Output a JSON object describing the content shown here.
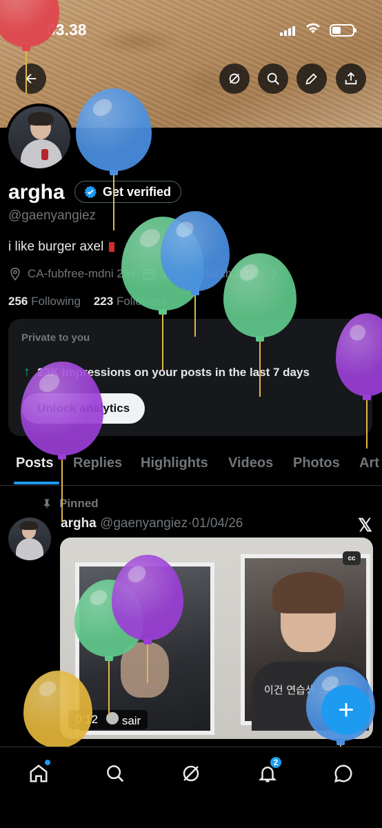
{
  "status_bar": {
    "time": "03.38"
  },
  "header": {
    "back_icon": "arrow-left-icon",
    "actions": [
      "grok-icon",
      "search-icon",
      "edit-icon",
      "share-icon"
    ]
  },
  "profile": {
    "name": "argha",
    "verify_label": "Get verified",
    "handle": "@gaenyangiez",
    "bio": "i like burger axel",
    "location": "CA-fubfree-mdni 25+",
    "joined": "Joined March 2022",
    "following_count": "256",
    "following_label": "Following",
    "followers_count": "223",
    "followers_label": "Followers"
  },
  "analytics_card": {
    "title": "Private to you",
    "close": "×",
    "impressions_text": "23K impressions on your posts in the last 7 days",
    "button_label": "Unlock analytics"
  },
  "tabs": [
    {
      "label": "Posts",
      "active": true
    },
    {
      "label": "Replies",
      "active": false
    },
    {
      "label": "Highlights",
      "active": false
    },
    {
      "label": "Videos",
      "active": false
    },
    {
      "label": "Photos",
      "active": false
    },
    {
      "label": "Art",
      "active": false
    }
  ],
  "post": {
    "pinned_label": "Pinned",
    "author": "argha",
    "handle": "@gaenyangiez",
    "separator": "·",
    "date": "01/04/26",
    "x_logo": "𝕏",
    "video": {
      "cc_label": "cc",
      "caption": "이건 연습생 ... 이",
      "duration": "0:12",
      "tag_user": "sair"
    }
  },
  "fab": {
    "label": "+"
  },
  "bottom_nav": {
    "items": [
      "home-icon",
      "search-icon",
      "grok-icon",
      "notifications-icon",
      "messages-icon"
    ],
    "notifications_badge": "2"
  },
  "colors": {
    "accent": "#1d9bf0",
    "balloon_blue": "#4a90e2",
    "balloon_green": "#5fc98a",
    "balloon_purple": "#9b3fd6",
    "balloon_yellow": "#e3b53a",
    "balloon_red": "#e0454e"
  }
}
